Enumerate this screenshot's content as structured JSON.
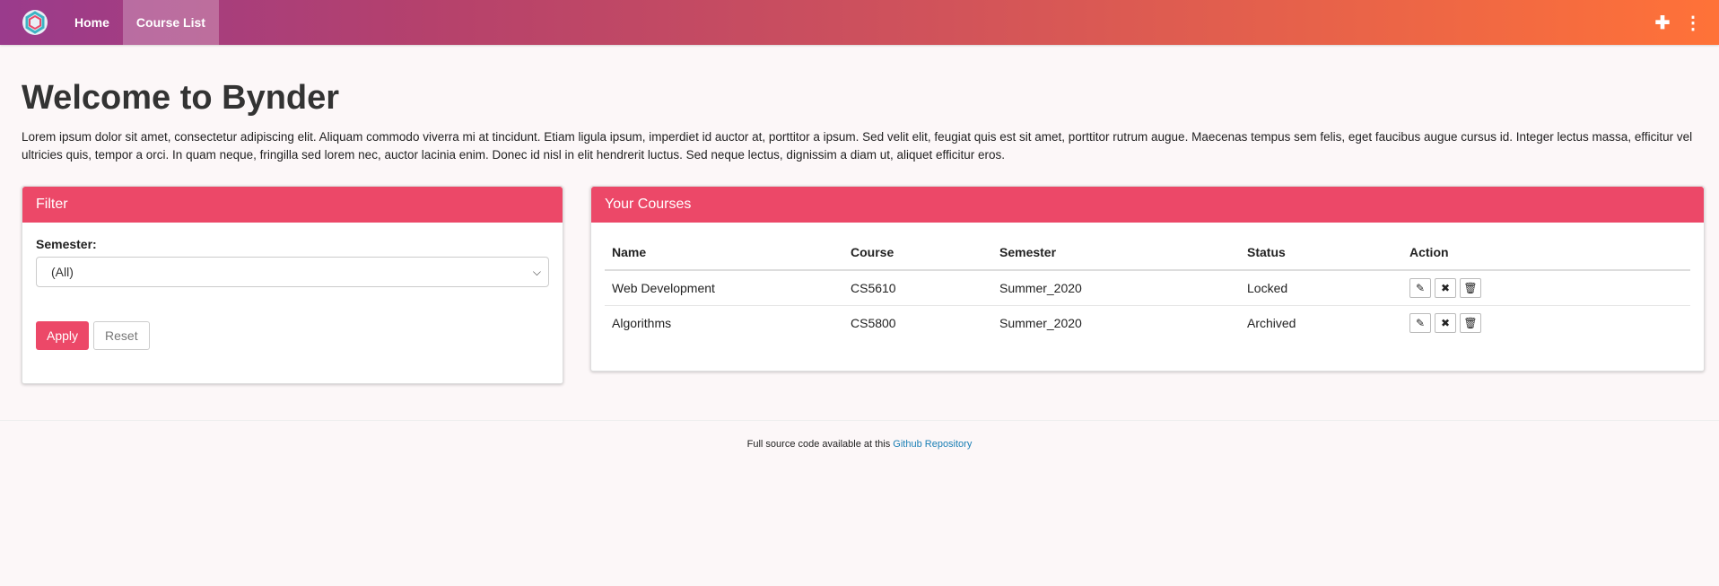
{
  "nav": {
    "links": [
      "Home",
      "Course List"
    ],
    "active": "Course List",
    "icons": [
      "plus-icon",
      "more-vertical-icon"
    ],
    "gradient": [
      "#9a3b8c",
      "#ff7238"
    ]
  },
  "page": {
    "title": "Welcome to Bynder",
    "intro": "Lorem ipsum dolor sit amet, consectetur adipiscing elit. Aliquam commodo viverra mi at tincidunt. Etiam ligula ipsum, imperdiet id auctor at, porttitor a ipsum. Sed velit elit, feugiat quis est sit amet, porttitor rutrum augue. Maecenas tempus sem felis, eget faucibus augue cursus id. Integer lectus massa, efficitur vel ultricies quis, tempor a orci. In quam neque, fringilla sed lorem nec, auctor lacinia enim. Donec id nisl in elit hendrerit luctus. Sed neque lectus, dignissim a diam ut, aliquet efficitur eros."
  },
  "filter": {
    "title": "Filter",
    "semester_label": "Semester:",
    "semester_value": "(All)",
    "apply_label": "Apply",
    "reset_label": "Reset"
  },
  "courses": {
    "title": "Your Courses",
    "columns": [
      "Name",
      "Course",
      "Semester",
      "Status",
      "Action"
    ],
    "rows": [
      {
        "name": "Web Development",
        "course": "CS5610",
        "semester": "Summer_2020",
        "status": "Locked"
      },
      {
        "name": "Algorithms",
        "course": "CS5800",
        "semester": "Summer_2020",
        "status": "Archived"
      }
    ],
    "action_icons": [
      "edit-icon",
      "close-icon",
      "trash-icon"
    ]
  },
  "footer": {
    "text": "Full source code available at this",
    "link_text": "Github Repository"
  },
  "colors": {
    "accent": "#ec4868",
    "link": "#1a7fb5"
  }
}
